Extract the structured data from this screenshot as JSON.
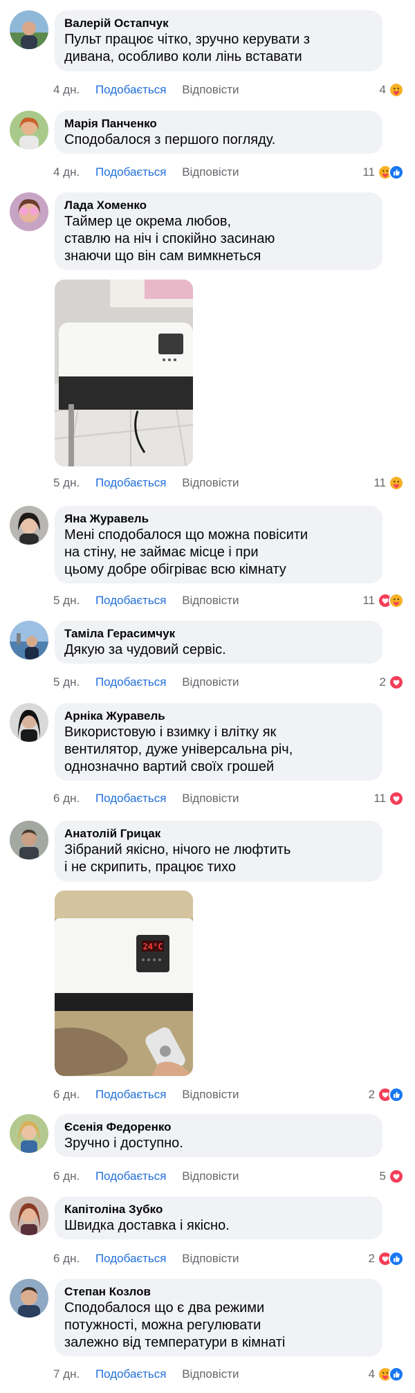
{
  "actions": {
    "like_label": "Подобається",
    "reply_label": "Відповісти"
  },
  "colors": {
    "bubble": "#f0f2f5",
    "like_link": "#216fdb",
    "muted": "#65676b",
    "like_reaction": "#1877f2",
    "love_reaction": "#f33e58",
    "care_reaction": "#f7b125"
  },
  "comments": [
    {
      "author": "Валерій Остапчук",
      "text": "Пульт працює чітко, зручно керувати з\nдивана, особливо коли лінь вставати",
      "time": "4 дн.",
      "reaction_count": "4",
      "reactions": [
        "care-reaction-icon"
      ]
    },
    {
      "author": "Марія Панченко",
      "text": "Сподобалося з першого погляду.",
      "time": "4 дн.",
      "reaction_count": "11",
      "reactions": [
        "care-reaction-icon",
        "like-reaction-icon"
      ]
    },
    {
      "author": "Лада Хоменко",
      "text": "Таймер це окрема любов,\nставлю на ніч і спокійно засинаю\nзнаючи що він сам вимкнеться",
      "time": "5 дн.",
      "reaction_count": "11",
      "reactions": [
        "care-reaction-icon"
      ],
      "photo": "heater-photo"
    },
    {
      "author": "Яна Журавель",
      "text": "Мені сподобалося що можна повісити\nна стіну, не займає місце і при\nцьому добре обігріває всю кімнату",
      "time": "5 дн.",
      "reaction_count": "11",
      "reactions": [
        "love-reaction-icon",
        "care-reaction-icon"
      ]
    },
    {
      "author": "Таміла Герасимчук",
      "text": "Дякую за чудовий сервіс.",
      "time": "5 дн.",
      "reaction_count": "2",
      "reactions": [
        "love-reaction-icon"
      ]
    },
    {
      "author": "Арніка Журавель",
      "text": "Використовую і взимку і влітку як\nвентилятор, дуже універсальна річ,\nоднозначно вартий своїх грошей",
      "time": "6 дн.",
      "reaction_count": "11",
      "reactions": [
        "love-reaction-icon"
      ]
    },
    {
      "author": "Анатолій Грицак",
      "text": "Зібраний якісно, нічого не люфтить\nі не скрипить, працює тихо",
      "time": "6 дн.",
      "reaction_count": "2",
      "reactions": [
        "love-reaction-icon",
        "like-reaction-icon"
      ],
      "photo": "heater-photo",
      "photo_display": "24°C"
    },
    {
      "author": "Єсенія Федоренко",
      "text": "Зручно і доступно.",
      "time": "6 дн.",
      "reaction_count": "5",
      "reactions": [
        "love-reaction-icon"
      ]
    },
    {
      "author": "Капітоліна Зубко",
      "text": "Швидка доставка і якісно.",
      "time": "6 дн.",
      "reaction_count": "2",
      "reactions": [
        "love-reaction-icon",
        "like-reaction-icon"
      ]
    },
    {
      "author": "Степан Козлов",
      "text": "Сподобалося що є два режими\nпотужності, можна регулювати\nзалежно від температури в кімнаті",
      "time": "7 дн.",
      "reaction_count": "4",
      "reactions": [
        "care-reaction-icon",
        "like-reaction-icon"
      ]
    }
  ]
}
